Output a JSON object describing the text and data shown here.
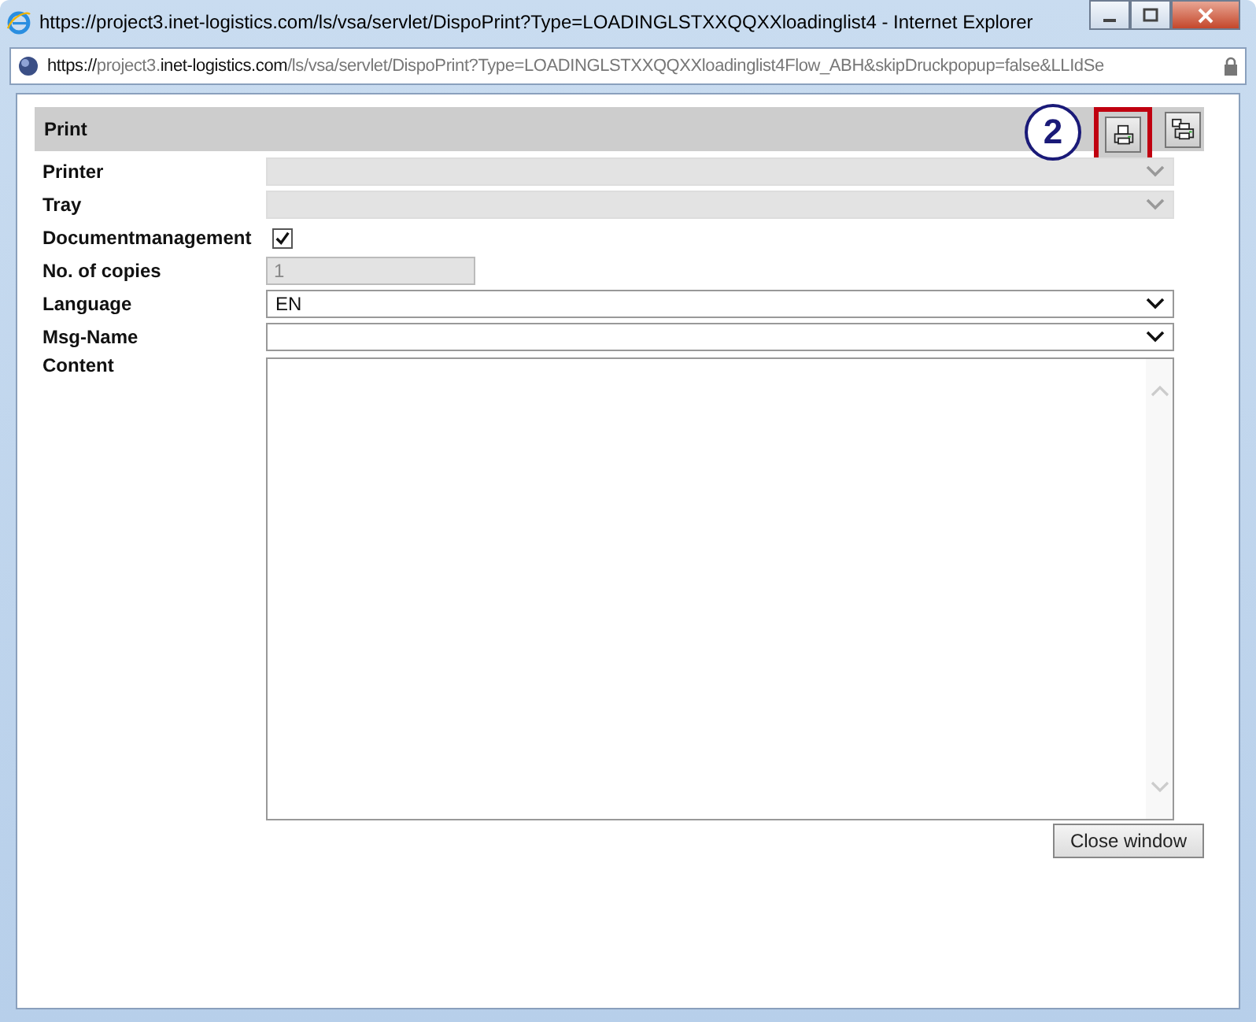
{
  "window": {
    "title": "https://project3.inet-logistics.com/ls/vsa/servlet/DispoPrint?Type=LOADINGLSTXXQQXXloadinglist4 - Internet Explorer"
  },
  "address_bar": {
    "url_parts": [
      {
        "text": "https://",
        "emphasis": true
      },
      {
        "text": "project3.",
        "emphasis": false
      },
      {
        "text": "inet-logistics.com",
        "emphasis": true
      },
      {
        "text": "/ls/vsa/servlet/DispoPrint?Type=LOADINGLSTXXQQXXloadinglist4Flow_ABH&skipDruckpopup=false&LLIdSe",
        "emphasis": false
      }
    ]
  },
  "panel": {
    "title": "Print",
    "callout": "2",
    "toolbar": [
      {
        "kind": "print",
        "highlighted": true
      },
      {
        "kind": "print-multi",
        "highlighted": false
      }
    ]
  },
  "fields": [
    {
      "label": "Printer",
      "kind": "select",
      "disabled": true
    },
    {
      "label": "Tray",
      "kind": "select",
      "disabled": true
    },
    {
      "label": "Documentmanagement",
      "kind": "checkbox",
      "checked": true
    },
    {
      "label": "No. of copies",
      "kind": "text",
      "value": "1",
      "disabled": true
    },
    {
      "label": "Language",
      "kind": "select",
      "value": "EN",
      "disabled": false
    },
    {
      "label": "Msg-Name",
      "kind": "select",
      "disabled": false
    },
    {
      "label": "Content",
      "kind": "textarea",
      "disabled": false
    }
  ],
  "buttons": [
    {
      "label": "Close window"
    }
  ]
}
